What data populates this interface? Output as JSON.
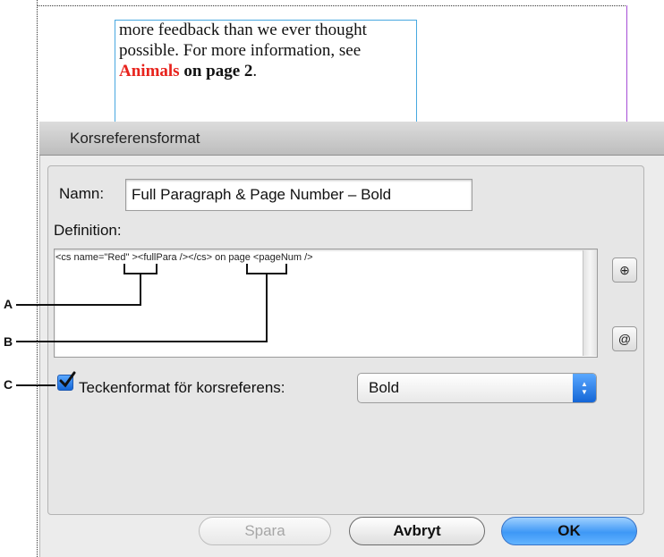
{
  "document": {
    "line1": "more feedback than we ever thought",
    "line2": "possible. For more information, see",
    "link_text": "Animals",
    "page_ref": "on page 2",
    "period": "."
  },
  "dialog": {
    "title": "Korsreferensformat",
    "name_label": "Namn:",
    "name_value": "Full Paragraph & Page Number – Bold",
    "definition_label": "Definition:",
    "definition_text": "<cs name=\"Red\" ><fullPara /></cs> on page <pageNum />",
    "insert_text_button": "⊕",
    "insert_special_button": "@",
    "checkbox_label": "Teckenformat för korsreferens:",
    "checkbox_checked": true,
    "char_style_value": "Bold",
    "buttons": {
      "save": "Spara",
      "cancel": "Avbryt",
      "ok": "OK"
    }
  },
  "callouts": {
    "a": "A",
    "b": "B",
    "c": "C"
  },
  "colors": {
    "link_red": "#e8231d",
    "frame_blue": "#48a8e0",
    "guide_purple": "#a64dd6",
    "aqua_blue": "#3e98f6"
  }
}
